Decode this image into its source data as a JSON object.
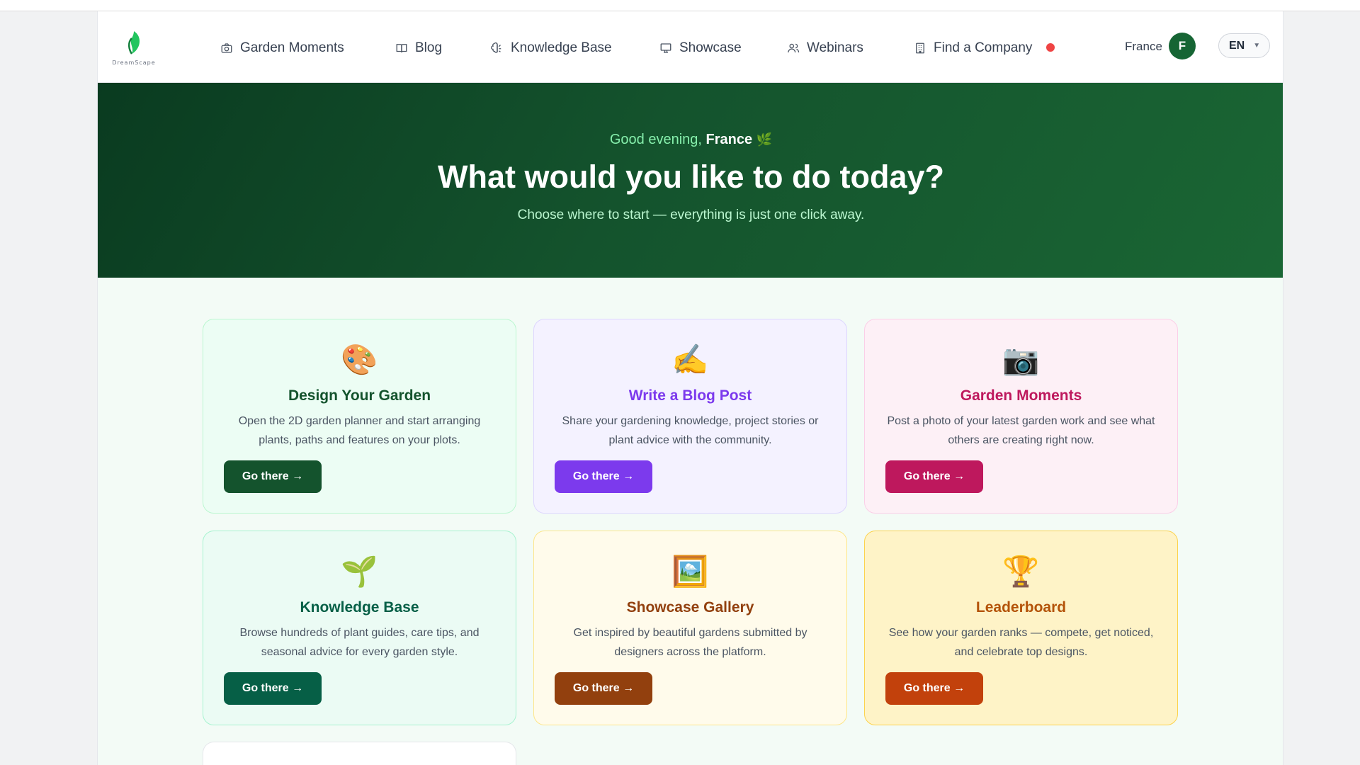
{
  "nav": {
    "logo_text": "DreamScape",
    "items": [
      {
        "label": "Garden Moments",
        "icon": "camera-icon"
      },
      {
        "label": "Blog",
        "icon": "book-icon"
      },
      {
        "label": "Knowledge Base",
        "icon": "brain-icon"
      },
      {
        "label": "Showcase",
        "icon": "presentation-icon"
      },
      {
        "label": "Webinars",
        "icon": "users-icon"
      },
      {
        "label": "Find a Company",
        "icon": "building-icon"
      }
    ],
    "user_name": "France",
    "avatar_initial": "F",
    "language": "EN"
  },
  "hero": {
    "greeting_prefix": "Good evening,",
    "greeting_name": "France",
    "greeting_emoji": "🌿",
    "title": "What would you like to do today?",
    "subtitle": "Choose where to start — everything is just one click away."
  },
  "cards": [
    {
      "emoji": "🎨",
      "title": "Design Your Garden",
      "description": "Open the 2D garden planner and start arranging plants, paths and features on your plots.",
      "button": "Go there →",
      "accent": "#14532d"
    },
    {
      "emoji": "✍️",
      "title": "Write a Blog Post",
      "description": "Share your gardening knowledge, project stories or plant advice with the community.",
      "button": "Go there →",
      "accent": "#7c3aed"
    },
    {
      "emoji": "📷",
      "title": "Garden Moments",
      "description": "Post a photo of your latest garden work and see what others are creating right now.",
      "button": "Go there →",
      "accent": "#be185d"
    },
    {
      "emoji": "🌱",
      "title": "Knowledge Base",
      "description": "Browse hundreds of plant guides, care tips, and seasonal advice for every garden style.",
      "button": "Go there →",
      "accent": "#065f46"
    },
    {
      "emoji": "🖼️",
      "title": "Showcase Gallery",
      "description": "Get inspired by beautiful gardens submitted by designers across the platform.",
      "button": "Go there →",
      "accent": "#92400e"
    },
    {
      "emoji": "🏆",
      "title": "Leaderboard",
      "description": "See how your garden ranks — compete, get noticed, and celebrate top designs.",
      "button": "Go there →",
      "accent": "#c2410c"
    }
  ],
  "colors": {
    "brand_green": "#14532d",
    "notification": "#ef4444"
  }
}
